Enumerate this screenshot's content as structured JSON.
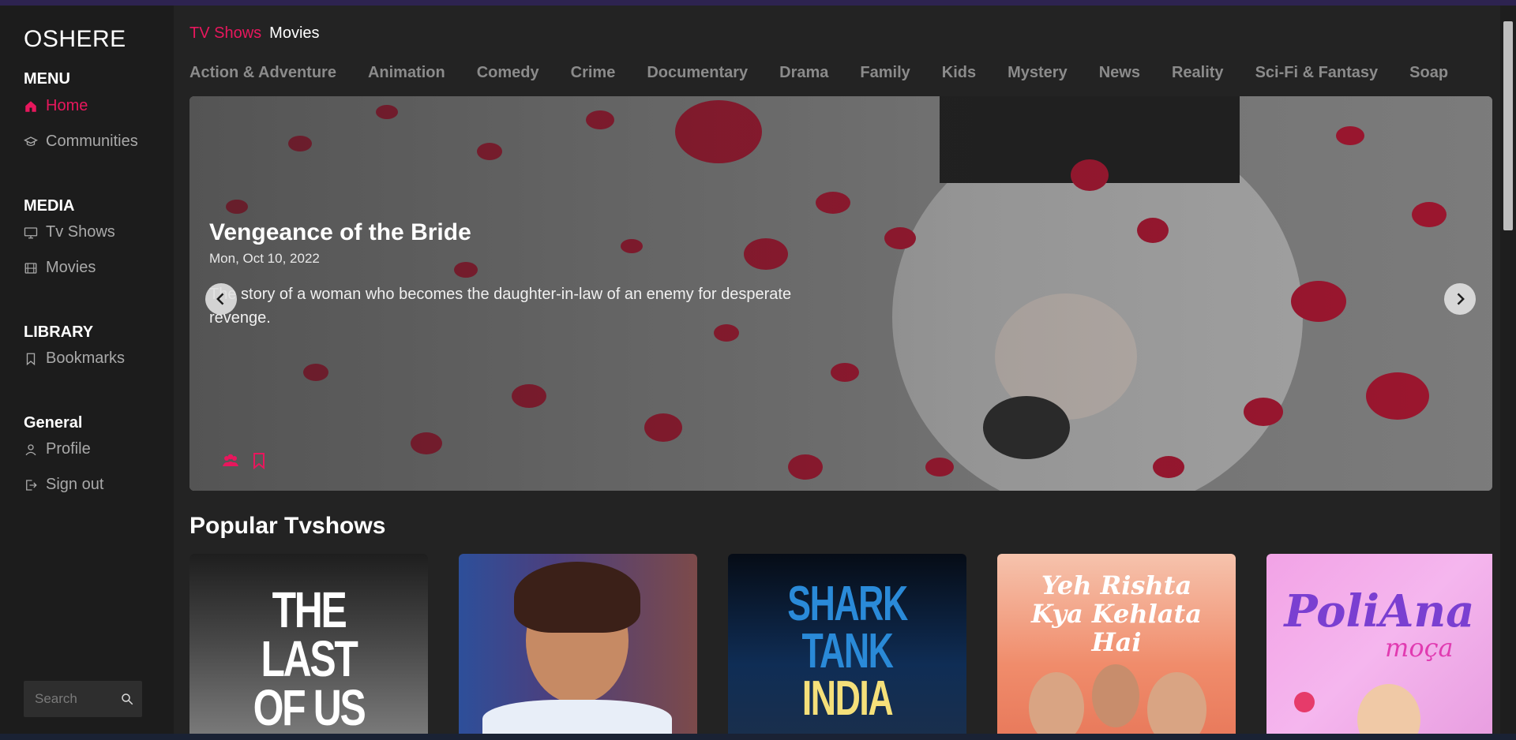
{
  "app": {
    "logo": "OSHERE"
  },
  "sidebar": {
    "menu_title": "MENU",
    "menu_items": [
      {
        "label": "Home",
        "icon": "home-icon",
        "active": true
      },
      {
        "label": "Communities",
        "icon": "graduation-cap-icon"
      }
    ],
    "media_title": "MEDIA",
    "media_items": [
      {
        "label": "Tv Shows",
        "icon": "monitor-icon"
      },
      {
        "label": "Movies",
        "icon": "film-icon"
      }
    ],
    "library_title": "LIBRARY",
    "library_items": [
      {
        "label": "Bookmarks",
        "icon": "bookmark-icon"
      }
    ],
    "general_title": "General",
    "general_items": [
      {
        "label": "Profile",
        "icon": "user-icon"
      },
      {
        "label": "Sign out",
        "icon": "sign-out-icon"
      }
    ],
    "search": {
      "placeholder": "Search",
      "value": ""
    }
  },
  "type_tabs": [
    {
      "label": "TV Shows",
      "active": true
    },
    {
      "label": "Movies",
      "active": false
    }
  ],
  "genres": [
    "Action & Adventure",
    "Animation",
    "Comedy",
    "Crime",
    "Documentary",
    "Drama",
    "Family",
    "Kids",
    "Mystery",
    "News",
    "Reality",
    "Sci-Fi & Fantasy",
    "Soap"
  ],
  "hero": {
    "title": "Vengeance of the Bride",
    "date": "Mon, Oct 10, 2022",
    "description": "The story of a woman who becomes the daughter-in-law of an enemy for desperate revenge."
  },
  "popular": {
    "title": "Popular Tvshows",
    "cards": [
      {
        "poster_text": "THE LAST OF US"
      },
      {
        "poster_text": ""
      },
      {
        "poster_text": "SHARK TANK",
        "poster_text_2": "INDIA"
      },
      {
        "poster_text": "Yeh Rishta Kya Kehlata Hai"
      },
      {
        "poster_text": "PoliAna",
        "poster_text_2": "moça"
      }
    ]
  },
  "colors": {
    "accent": "#e8175d",
    "background": "#232323",
    "sidebar": "#1c1c1c"
  }
}
